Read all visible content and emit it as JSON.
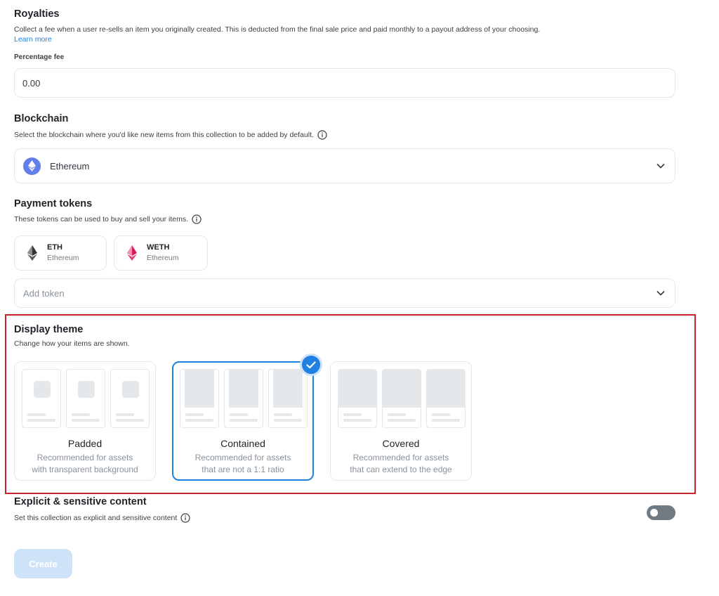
{
  "royalties": {
    "title": "Royalties",
    "description": "Collect a fee when a user re-sells an item you originally created. This is deducted from the final sale price and paid monthly to a payout address of your choosing.",
    "learn_more": "Learn more",
    "percentage_label": "Percentage fee",
    "percentage_value": "0.00"
  },
  "blockchain": {
    "title": "Blockchain",
    "description": "Select the blockchain where you'd like new items from this collection to be added by default.",
    "selected": "Ethereum",
    "selected_icon": "ethereum-icon"
  },
  "payment_tokens": {
    "title": "Payment tokens",
    "description": "These tokens can be used to buy and sell your items.",
    "tokens": [
      {
        "symbol": "ETH",
        "network": "Ethereum",
        "icon": "eth-icon"
      },
      {
        "symbol": "WETH",
        "network": "Ethereum",
        "icon": "weth-icon"
      }
    ],
    "add_token_placeholder": "Add token"
  },
  "display_theme": {
    "title": "Display theme",
    "description": "Change how your items are shown.",
    "selected": "Contained",
    "options": [
      {
        "name": "Padded",
        "line1": "Recommended for assets",
        "line2": "with transparent background"
      },
      {
        "name": "Contained",
        "line1": "Recommended for assets",
        "line2": "that are not a 1:1 ratio"
      },
      {
        "name": "Covered",
        "line1": "Recommended for assets",
        "line2": "that can extend to the edge"
      }
    ]
  },
  "explicit": {
    "title": "Explicit & sensitive content",
    "description": "Set this collection as explicit and sensitive content",
    "enabled": false
  },
  "create_button": "Create",
  "colors": {
    "accent": "#2081e2",
    "highlight": "#c8232c",
    "ethereum": "#627eea",
    "weth": "#ec407a",
    "disabled_button": "#cfe3f8"
  }
}
